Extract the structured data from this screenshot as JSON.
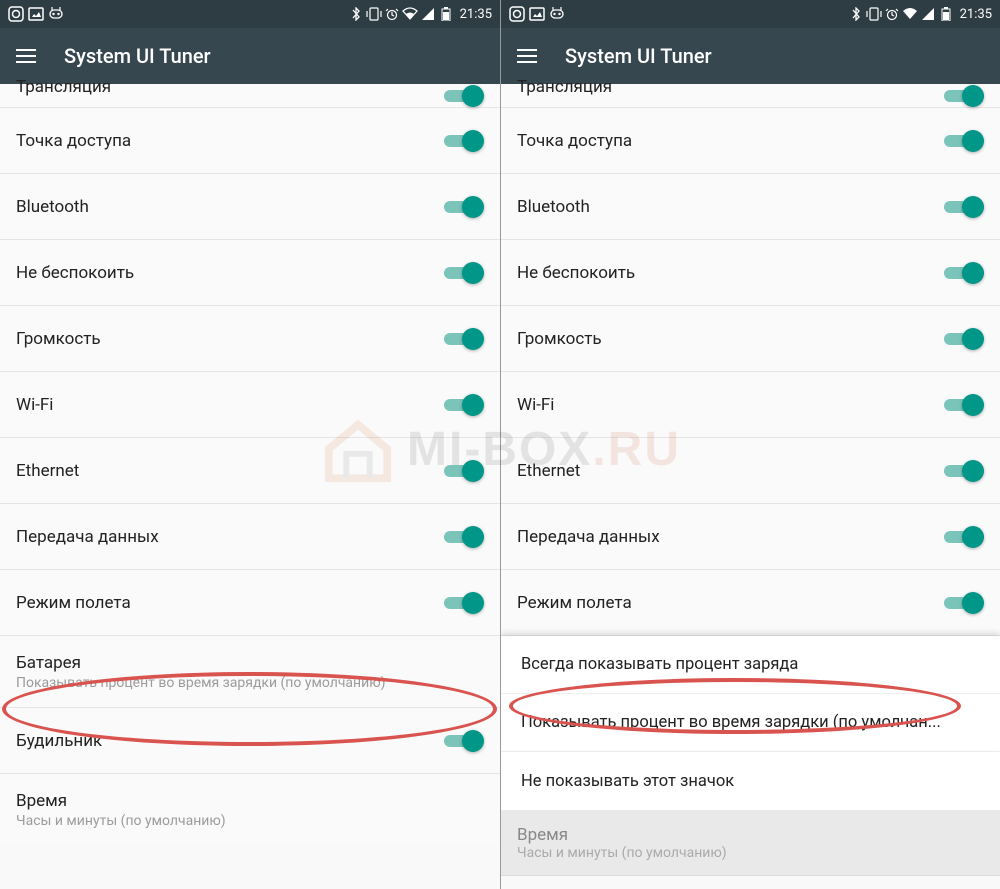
{
  "status": {
    "time": "21:35"
  },
  "app": {
    "title": "System UI Tuner"
  },
  "items": {
    "broadcast": "Трансляция",
    "hotspot": "Точка доступа",
    "bluetooth": "Bluetooth",
    "dnd": "Не беспокоить",
    "volume": "Громкость",
    "wifi": "Wi-Fi",
    "ethernet": "Ethernet",
    "data": "Передача данных",
    "airplane": "Режим полета",
    "battery": "Батарея",
    "battery_sub": "Показывать процент во время зарядки (по умолчанию)",
    "alarm": "Будильник",
    "time_row": "Время",
    "time_sub": "Часы и минуты (по умолчанию)",
    "option_always": "Всегда показывать процент заряда",
    "option_charging": "Показывать процент во время зарядки (по умолчан...",
    "option_never": "Не показывать этот значок"
  },
  "watermark": {
    "prefix": "MI-BOX",
    "suffix": ".RU"
  }
}
